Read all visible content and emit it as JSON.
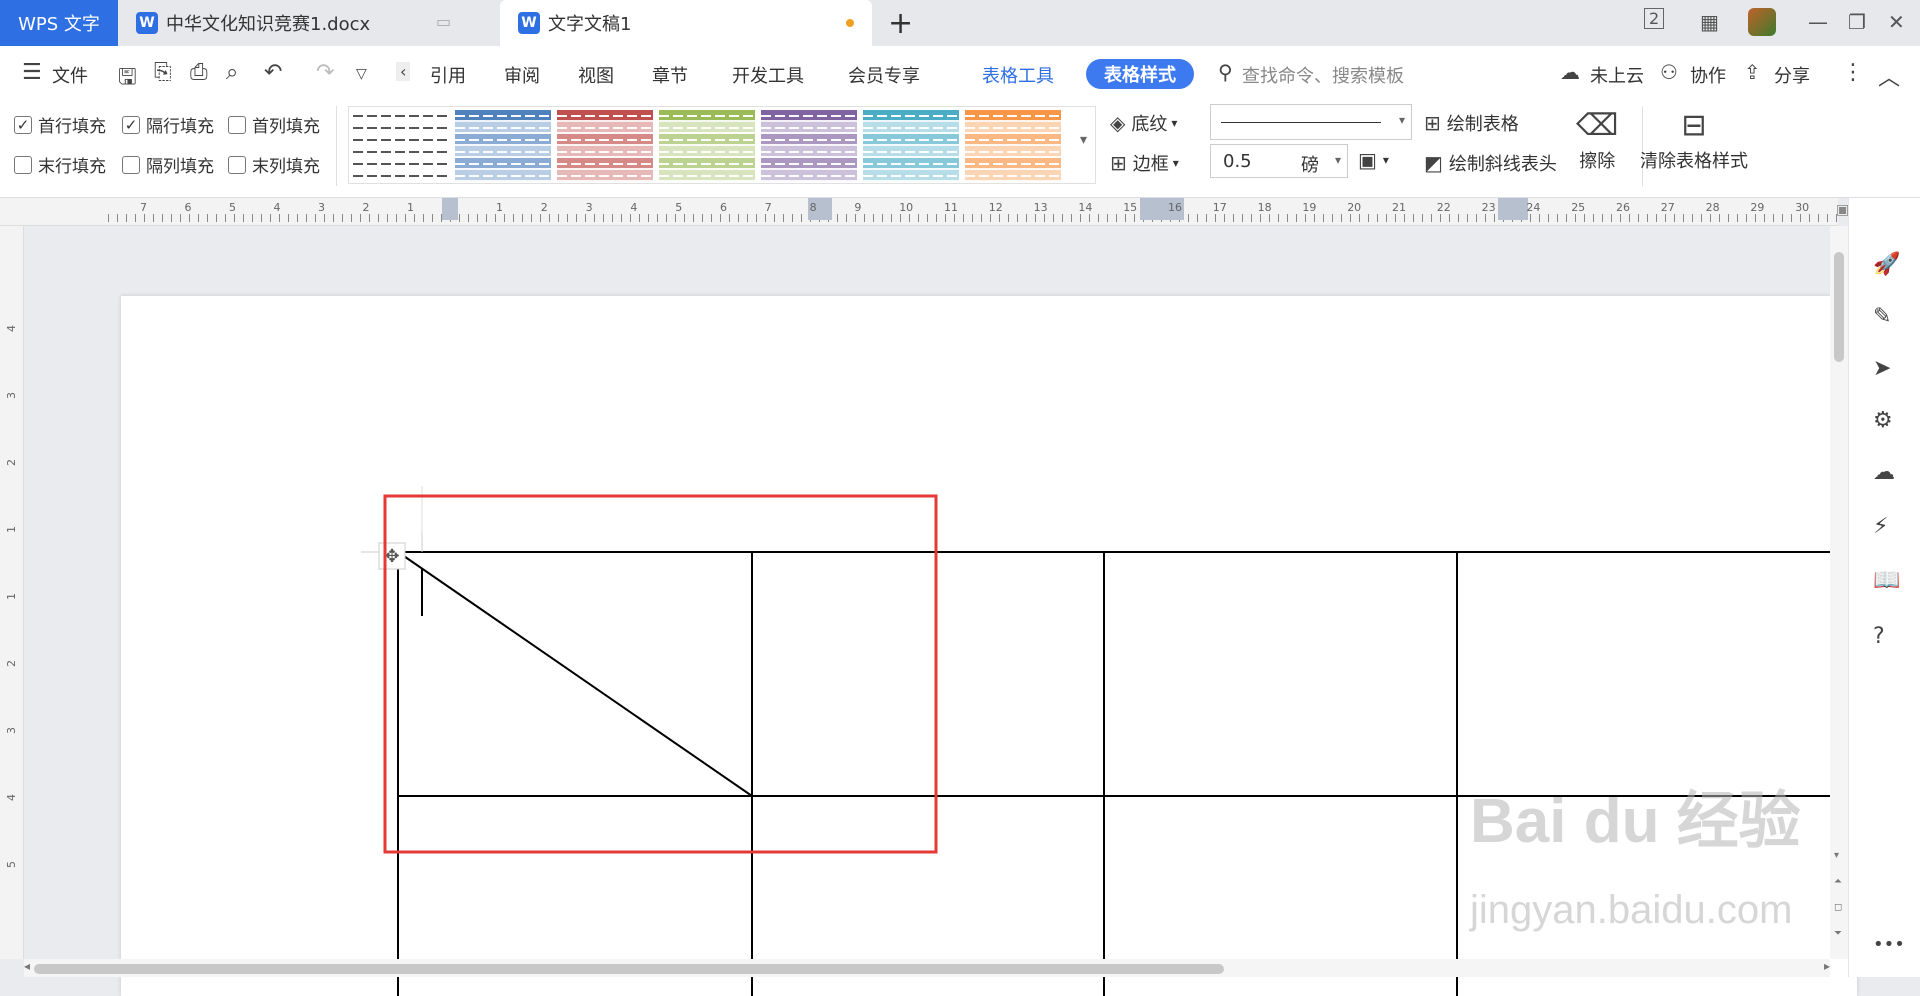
{
  "app": {
    "brand": "WPS 文字"
  },
  "tabs": [
    {
      "label": "中华文化知识竞赛1.docx"
    },
    {
      "label": "文字文稿1"
    }
  ],
  "titlebar": {
    "page_count": "2"
  },
  "menu": {
    "file": "文件",
    "items": [
      "引用",
      "审阅",
      "视图",
      "章节",
      "开发工具",
      "会员专享"
    ],
    "table_tools": "表格工具",
    "table_style": "表格样式",
    "search_placeholder": "查找命令、搜索模板",
    "cloud": "未上云",
    "collab": "协作",
    "share": "分享"
  },
  "ribbon": {
    "checks": [
      {
        "label": "首行填充",
        "checked": true
      },
      {
        "label": "隔行填充",
        "checked": true
      },
      {
        "label": "首列填充",
        "checked": false
      },
      {
        "label": "末行填充",
        "checked": false
      },
      {
        "label": "隔列填充",
        "checked": false
      },
      {
        "label": "末列填充",
        "checked": false
      }
    ],
    "style_colors": [
      "#ffffff",
      "#4f81bd",
      "#c0504d",
      "#9bbb59",
      "#8064a2",
      "#4bacc6",
      "#f79646"
    ],
    "shading": "底纹",
    "border": "边框",
    "line_weight": "0.5",
    "unit": "磅",
    "draw_table": "绘制表格",
    "draw_diagonal": "绘制斜线表头",
    "erase": "擦除",
    "clear_style": "清除表格样式"
  },
  "ruler": {
    "h_left": [
      "7",
      "6",
      "5",
      "4",
      "3",
      "2",
      "1"
    ],
    "h_right": [
      "1",
      "2",
      "3",
      "4",
      "5",
      "6",
      "7",
      "8",
      "9",
      "10",
      "11",
      "12",
      "13",
      "14",
      "15",
      "16",
      "17",
      "18",
      "19",
      "20",
      "21",
      "22",
      "23",
      "24",
      "25",
      "26",
      "27",
      "28",
      "29",
      "30"
    ],
    "v": [
      "4",
      "3",
      "2",
      "1",
      "1",
      "2",
      "3",
      "4",
      "5"
    ]
  },
  "watermark": {
    "main": "Bai du 经验",
    "sub": "jingyan.baidu.com"
  },
  "colors": {
    "accent": "#2f6fe4",
    "highlight": "#e53935"
  }
}
